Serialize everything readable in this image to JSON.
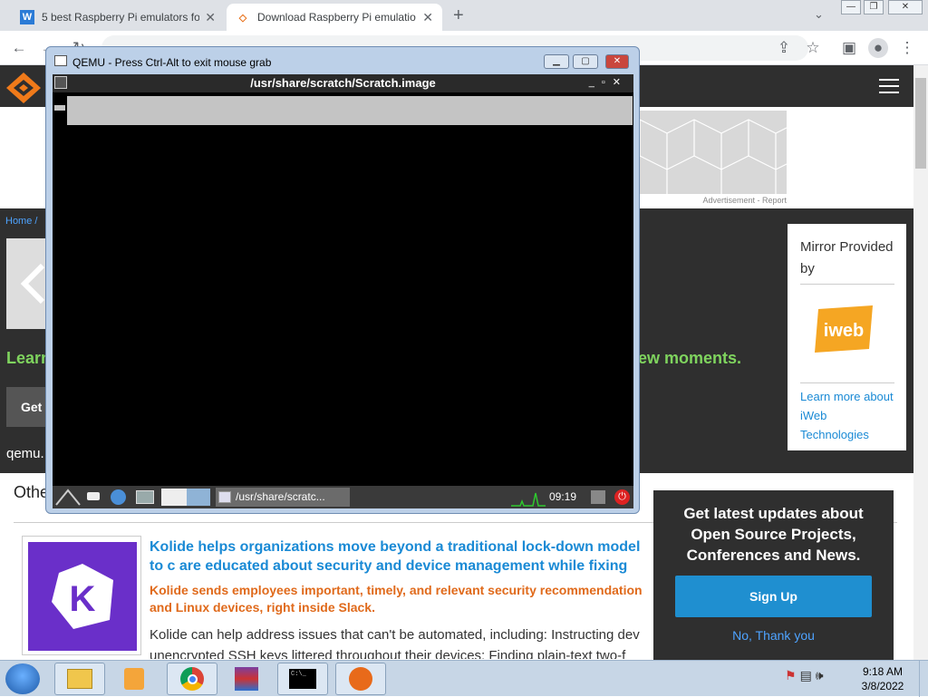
{
  "browser": {
    "tabs": [
      {
        "title": "5 best Raspberry Pi emulators fo",
        "favicon": "W"
      },
      {
        "title": "Download Raspberry Pi emulatio",
        "favicon": "◇"
      }
    ],
    "new_tab": "+",
    "url": ""
  },
  "page": {
    "breadcrumb": "Home / ",
    "learn_prefix": "Learn",
    "learn_suffix": "ew moments.",
    "get_button": "Get",
    "qemu_text": "qemu.",
    "other_heading": "Othe",
    "ad_label": "Advertisement - Report",
    "mirror": {
      "title": "Mirror Provided by",
      "logo_text": "iweb",
      "link": "Learn more about iWeb Technologies"
    },
    "kolide": {
      "logo_letter": "K",
      "headline": "Kolide helps organizations move beyond a traditional lock-down model to c are educated about security and device management while fixing nuanced p",
      "subhead": "Kolide sends employees important, timely, and relevant security recommendation and Linux devices, right inside Slack.",
      "body": "Kolide can help address issues that can't be automated, including: Instructing dev unencrypted SSH keys littered throughout their devices; Finding plain-text two-f"
    },
    "popup": {
      "text": "Get latest updates about Open Source Projects, Conferences and News.",
      "signup": "Sign Up",
      "no_thanks": "No, Thank you"
    }
  },
  "qemu": {
    "title": "QEMU - Press Ctrl-Alt to exit mouse grab",
    "guest_window_title": "/usr/share/scratch/Scratch.image",
    "guest_task_item": "/usr/share/scratc...",
    "guest_clock": "09:19"
  },
  "taskbar": {
    "time": "9:18 AM",
    "date": "3/8/2022"
  }
}
